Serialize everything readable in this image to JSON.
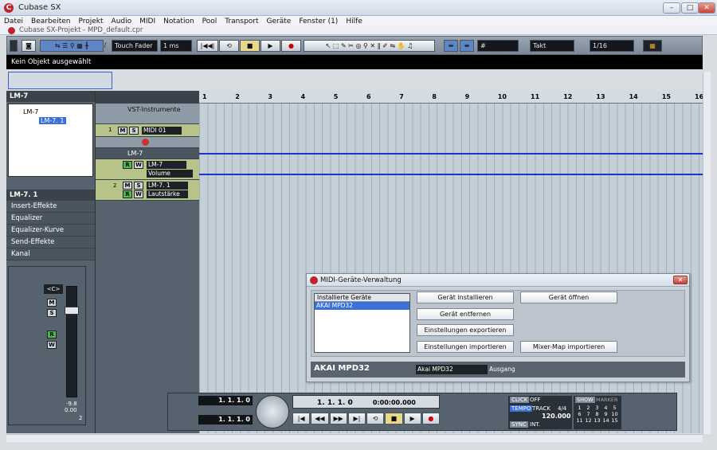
{
  "app": {
    "title": "Cubase SX",
    "project_title": "Cubase SX-Projekt - MPD_default.cpr"
  },
  "menu": [
    "Datei",
    "Bearbeiten",
    "Projekt",
    "Audio",
    "MIDI",
    "Notation",
    "Pool",
    "Transport",
    "Geräte",
    "Fenster (1)",
    "Hilfe"
  ],
  "toolbar": {
    "automation_mode": "Touch Fader",
    "latency": "1 ms",
    "quantize_grid": "Takt",
    "quantize_value": "1/16"
  },
  "infobar": {
    "text": "Kein Objekt ausgewählt"
  },
  "inspector": {
    "device": "LM-7",
    "tree": [
      "LM-7",
      "LM-7. 1"
    ],
    "track": "LM-7. 1",
    "sections": [
      "Insert-Effekte",
      "Equalizer",
      "Equalizer-Kurve",
      "Send-Effekte",
      "Kanal"
    ],
    "mixer_value_top": "-9.8",
    "mixer_value": "0.00",
    "mixer_channel": "2",
    "pan": "<C>"
  },
  "tracks": {
    "folder_label": "VST-Instrumente",
    "midi_track_num": "1",
    "midi_track_name": "MIDI 01",
    "folder2_label": "LM-7",
    "lm7_name": "LM-7",
    "lm7_param": "Volume",
    "lm71_num": "2",
    "lm71_name": "LM-7. 1",
    "lm71_param": "Lautstärke"
  },
  "ruler": [
    "1",
    "2",
    "3",
    "4",
    "5",
    "6",
    "7",
    "8",
    "9",
    "10",
    "11",
    "12",
    "13",
    "14",
    "15",
    "16"
  ],
  "dialog": {
    "title": "MIDI-Geräte-Verwaltung",
    "list_header": "Installierte Geräte",
    "list_items": [
      "AKAI MPD32"
    ],
    "buttons": {
      "install": "Gerät installieren",
      "remove": "Gerät entfernen",
      "export": "Einstellungen exportieren",
      "import": "Einstellungen importieren",
      "open": "Gerät öffnen",
      "mixer_map": "Mixer-Map importieren"
    },
    "device_name": "AKAI MPD32",
    "output_value": "Akai MPD32",
    "output_label": "Ausgang"
  },
  "transport": {
    "left_locator": "1. 1. 1.   0",
    "right_locator": "1. 1. 1.   0",
    "left_small": "0",
    "right_small": "0",
    "position": "1. 1. 1.   0",
    "time": "0:00:00.000",
    "click_label": "CLICK",
    "click_value": "OFF",
    "tempo_label": "TEMPO",
    "tempo_mode": "TRACK",
    "signature": "4/4",
    "tempo": "120.000",
    "sync_label": "SYNC",
    "sync_value": "INT.",
    "show_label": "SHOW",
    "marker_label": "MARKER",
    "markers": [
      "1",
      "2",
      "3",
      "4",
      "5",
      "6",
      "7",
      "8",
      "9",
      "10",
      "11",
      "12",
      "13",
      "14",
      "15"
    ]
  }
}
